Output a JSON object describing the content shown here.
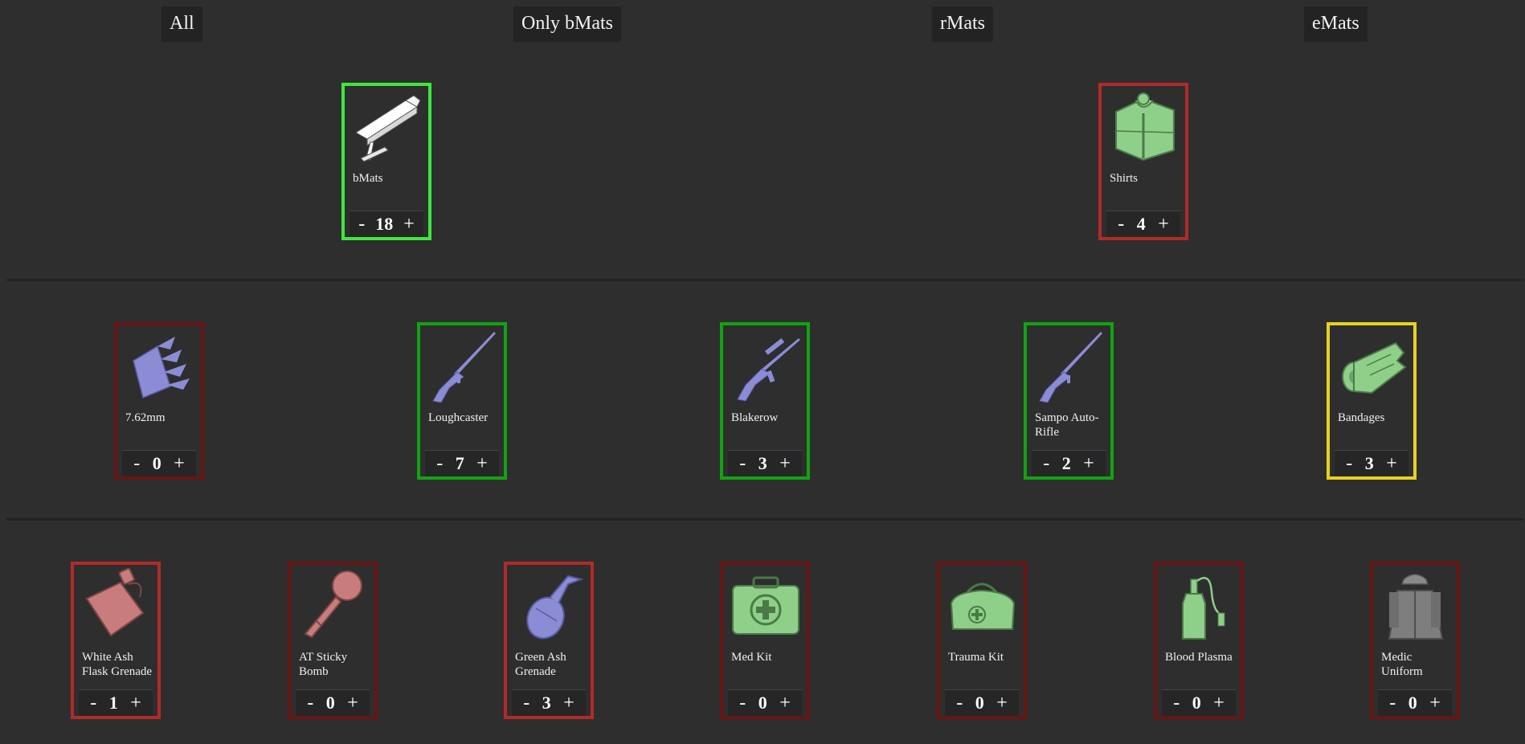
{
  "filters": [
    {
      "label": "All"
    },
    {
      "label": "Only bMats"
    },
    {
      "label": "rMats"
    },
    {
      "label": "eMats"
    }
  ],
  "row1": [
    {
      "name": "bMats",
      "qty": "18",
      "icon": "steel-beam-icon",
      "border": "#3ee83e"
    },
    {
      "name": "Shirts",
      "qty": "4",
      "icon": "shirts-icon",
      "border": "#b22a2a"
    }
  ],
  "row2": [
    {
      "name": "7.62mm",
      "qty": "0",
      "icon": "ammo-clip-icon",
      "border": "#6b1414"
    },
    {
      "name": "Loughcaster",
      "qty": "7",
      "icon": "rifle-icon",
      "border": "#12a312"
    },
    {
      "name": "Blakerow",
      "qty": "3",
      "icon": "assault-rifle-icon",
      "border": "#12a312"
    },
    {
      "name": "Sampo Auto-Rifle",
      "qty": "2",
      "icon": "rifle-icon",
      "border": "#12a312"
    },
    {
      "name": "Bandages",
      "qty": "3",
      "icon": "bandages-icon",
      "border": "#e6d21e"
    }
  ],
  "row3": [
    {
      "name": "White Ash Flask Grenade",
      "qty": "1",
      "icon": "flask-icon",
      "border": "#b22a2a"
    },
    {
      "name": "AT Sticky Bomb",
      "qty": "0",
      "icon": "sticky-bomb-icon",
      "border": "#6b1414"
    },
    {
      "name": "Green Ash Grenade",
      "qty": "3",
      "icon": "gas-grenade-icon",
      "border": "#b22a2a"
    },
    {
      "name": "Med Kit",
      "qty": "0",
      "icon": "med-kit-icon",
      "border": "#6b1414"
    },
    {
      "name": "Trauma Kit",
      "qty": "0",
      "icon": "trauma-kit-icon",
      "border": "#6b1414"
    },
    {
      "name": "Blood Plasma",
      "qty": "0",
      "icon": "blood-plasma-icon",
      "border": "#6b1414"
    },
    {
      "name": "Medic Uniform",
      "qty": "0",
      "icon": "uniform-icon",
      "border": "#6b1414"
    }
  ],
  "controls": {
    "minus": "-",
    "plus": "+"
  },
  "colors": {
    "bg": "#2e2e2e",
    "panel": "#232323",
    "bmat_icon": "#ffffff",
    "weapon_icon": "#8c8cd6",
    "medical_icon": "#8ecf8a",
    "explosive_icon": "#c97c7c"
  }
}
